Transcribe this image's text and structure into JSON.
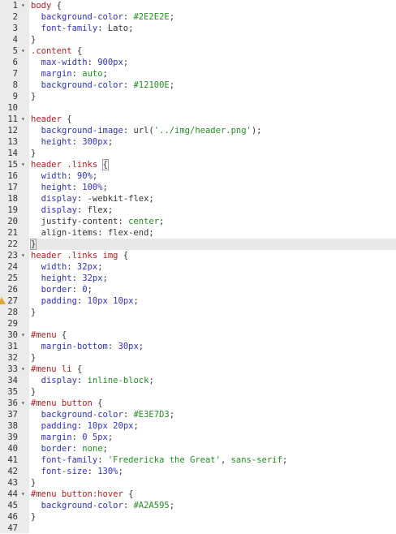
{
  "editor": {
    "lines": [
      {
        "n": "1",
        "fold": true,
        "tokens": [
          [
            "sel",
            "body"
          ],
          [
            "plain",
            " {"
          ]
        ]
      },
      {
        "n": "2",
        "tokens": [
          [
            "plain",
            "  "
          ],
          [
            "prop",
            "background-color"
          ],
          [
            "plain",
            ": "
          ],
          [
            "val",
            "#2E2E2E"
          ],
          [
            "plain",
            ";"
          ]
        ]
      },
      {
        "n": "3",
        "tokens": [
          [
            "plain",
            "  "
          ],
          [
            "prop",
            "font-family"
          ],
          [
            "plain",
            ": Lato;"
          ]
        ]
      },
      {
        "n": "4",
        "tokens": [
          [
            "plain",
            "}"
          ]
        ]
      },
      {
        "n": "5",
        "fold": true,
        "tokens": [
          [
            "sel",
            ".content"
          ],
          [
            "plain",
            " {"
          ]
        ]
      },
      {
        "n": "6",
        "tokens": [
          [
            "plain",
            "  "
          ],
          [
            "prop",
            "max-width"
          ],
          [
            "plain",
            ": "
          ],
          [
            "num-val",
            "900px"
          ],
          [
            "plain",
            ";"
          ]
        ]
      },
      {
        "n": "7",
        "tokens": [
          [
            "plain",
            "  "
          ],
          [
            "prop",
            "margin"
          ],
          [
            "plain",
            ": "
          ],
          [
            "val",
            "auto"
          ],
          [
            "plain",
            ";"
          ]
        ]
      },
      {
        "n": "8",
        "tokens": [
          [
            "plain",
            "  "
          ],
          [
            "prop",
            "background-color"
          ],
          [
            "plain",
            ": "
          ],
          [
            "val",
            "#12100E"
          ],
          [
            "plain",
            ";"
          ]
        ]
      },
      {
        "n": "9",
        "tokens": [
          [
            "plain",
            "}"
          ]
        ]
      },
      {
        "n": "10",
        "tokens": []
      },
      {
        "n": "11",
        "fold": true,
        "tokens": [
          [
            "sel",
            "header"
          ],
          [
            "plain",
            " {"
          ]
        ]
      },
      {
        "n": "12",
        "tokens": [
          [
            "plain",
            "  "
          ],
          [
            "prop",
            "background-image"
          ],
          [
            "plain",
            ": url("
          ],
          [
            "str",
            "'../img/header.png'"
          ],
          [
            "plain",
            ");"
          ]
        ]
      },
      {
        "n": "13",
        "tokens": [
          [
            "plain",
            "  "
          ],
          [
            "prop",
            "height"
          ],
          [
            "plain",
            ": "
          ],
          [
            "num-val",
            "300px"
          ],
          [
            "plain",
            ";"
          ]
        ]
      },
      {
        "n": "14",
        "tokens": [
          [
            "plain",
            "}"
          ]
        ]
      },
      {
        "n": "15",
        "fold": true,
        "tokens": [
          [
            "sel",
            "header .links"
          ],
          [
            "plain",
            " "
          ],
          [
            "bracket",
            "{"
          ]
        ]
      },
      {
        "n": "16",
        "tokens": [
          [
            "plain",
            "  "
          ],
          [
            "prop",
            "width"
          ],
          [
            "plain",
            ": "
          ],
          [
            "num-val",
            "90%"
          ],
          [
            "plain",
            ";"
          ]
        ]
      },
      {
        "n": "17",
        "tokens": [
          [
            "plain",
            "  "
          ],
          [
            "prop",
            "height"
          ],
          [
            "plain",
            ": "
          ],
          [
            "num-val",
            "100%"
          ],
          [
            "plain",
            ";"
          ]
        ]
      },
      {
        "n": "18",
        "tokens": [
          [
            "plain",
            "  "
          ],
          [
            "prop",
            "display"
          ],
          [
            "plain",
            ": -webkit-flex;"
          ]
        ]
      },
      {
        "n": "19",
        "tokens": [
          [
            "plain",
            "  "
          ],
          [
            "prop",
            "display"
          ],
          [
            "plain",
            ": flex;"
          ]
        ]
      },
      {
        "n": "20",
        "tokens": [
          [
            "plain",
            "  justify-content: "
          ],
          [
            "val",
            "center"
          ],
          [
            "plain",
            ";"
          ]
        ]
      },
      {
        "n": "21",
        "tokens": [
          [
            "plain",
            "  align-items: flex-end;"
          ]
        ]
      },
      {
        "n": "22",
        "active": true,
        "tokens": [
          [
            "bracket",
            "}"
          ]
        ]
      },
      {
        "n": "23",
        "fold": true,
        "tokens": [
          [
            "sel",
            "header .links img"
          ],
          [
            "plain",
            " {"
          ]
        ]
      },
      {
        "n": "24",
        "tokens": [
          [
            "plain",
            "  "
          ],
          [
            "prop",
            "width"
          ],
          [
            "plain",
            ": "
          ],
          [
            "num-val",
            "32px"
          ],
          [
            "plain",
            ";"
          ]
        ]
      },
      {
        "n": "25",
        "tokens": [
          [
            "plain",
            "  "
          ],
          [
            "prop",
            "height"
          ],
          [
            "plain",
            ": "
          ],
          [
            "num-val",
            "32px"
          ],
          [
            "plain",
            ";"
          ]
        ]
      },
      {
        "n": "26",
        "tokens": [
          [
            "plain",
            "  "
          ],
          [
            "prop",
            "border"
          ],
          [
            "plain",
            ": "
          ],
          [
            "num-val",
            "0"
          ],
          [
            "plain",
            ";"
          ]
        ]
      },
      {
        "n": "27",
        "warn": true,
        "tokens": [
          [
            "plain",
            "  "
          ],
          [
            "prop",
            "padding"
          ],
          [
            "plain",
            ": "
          ],
          [
            "num-val",
            "10px 10px"
          ],
          [
            "plain",
            ";"
          ]
        ]
      },
      {
        "n": "28",
        "tokens": [
          [
            "plain",
            "}"
          ]
        ]
      },
      {
        "n": "29",
        "tokens": []
      },
      {
        "n": "30",
        "fold": true,
        "tokens": [
          [
            "sel",
            "#menu"
          ],
          [
            "plain",
            " {"
          ]
        ]
      },
      {
        "n": "31",
        "tokens": [
          [
            "plain",
            "  "
          ],
          [
            "prop",
            "margin-bottom"
          ],
          [
            "plain",
            ": "
          ],
          [
            "num-val",
            "30px"
          ],
          [
            "plain",
            ";"
          ]
        ]
      },
      {
        "n": "32",
        "tokens": [
          [
            "plain",
            "}"
          ]
        ]
      },
      {
        "n": "33",
        "fold": true,
        "tokens": [
          [
            "sel",
            "#menu li"
          ],
          [
            "plain",
            " {"
          ]
        ]
      },
      {
        "n": "34",
        "tokens": [
          [
            "plain",
            "  "
          ],
          [
            "prop",
            "display"
          ],
          [
            "plain",
            ": "
          ],
          [
            "val",
            "inline-block"
          ],
          [
            "plain",
            ";"
          ]
        ]
      },
      {
        "n": "35",
        "tokens": [
          [
            "plain",
            "}"
          ]
        ]
      },
      {
        "n": "36",
        "fold": true,
        "tokens": [
          [
            "sel",
            "#menu button"
          ],
          [
            "plain",
            " {"
          ]
        ]
      },
      {
        "n": "37",
        "tokens": [
          [
            "plain",
            "  "
          ],
          [
            "prop",
            "background-color"
          ],
          [
            "plain",
            ": "
          ],
          [
            "val",
            "#E3E7D3"
          ],
          [
            "plain",
            ";"
          ]
        ]
      },
      {
        "n": "38",
        "tokens": [
          [
            "plain",
            "  "
          ],
          [
            "prop",
            "padding"
          ],
          [
            "plain",
            ": "
          ],
          [
            "num-val",
            "10px 20px"
          ],
          [
            "plain",
            ";"
          ]
        ]
      },
      {
        "n": "39",
        "tokens": [
          [
            "plain",
            "  "
          ],
          [
            "prop",
            "margin"
          ],
          [
            "plain",
            ": "
          ],
          [
            "num-val",
            "0 5px"
          ],
          [
            "plain",
            ";"
          ]
        ]
      },
      {
        "n": "40",
        "tokens": [
          [
            "plain",
            "  "
          ],
          [
            "prop",
            "border"
          ],
          [
            "plain",
            ": "
          ],
          [
            "val",
            "none"
          ],
          [
            "plain",
            ";"
          ]
        ]
      },
      {
        "n": "41",
        "tokens": [
          [
            "plain",
            "  "
          ],
          [
            "prop",
            "font-family"
          ],
          [
            "plain",
            ": "
          ],
          [
            "str",
            "'Fredericka the Great'"
          ],
          [
            "plain",
            ", "
          ],
          [
            "val",
            "sans-serif"
          ],
          [
            "plain",
            ";"
          ]
        ]
      },
      {
        "n": "42",
        "tokens": [
          [
            "plain",
            "  "
          ],
          [
            "prop",
            "font-size"
          ],
          [
            "plain",
            ": "
          ],
          [
            "num-val",
            "130%"
          ],
          [
            "plain",
            ";"
          ]
        ]
      },
      {
        "n": "43",
        "tokens": [
          [
            "plain",
            "}"
          ]
        ]
      },
      {
        "n": "44",
        "fold": true,
        "tokens": [
          [
            "sel",
            "#menu button:hover"
          ],
          [
            "plain",
            " {"
          ]
        ]
      },
      {
        "n": "45",
        "tokens": [
          [
            "plain",
            "  "
          ],
          [
            "prop",
            "background-color"
          ],
          [
            "plain",
            ": "
          ],
          [
            "val",
            "#A2A595"
          ],
          [
            "plain",
            ";"
          ]
        ]
      },
      {
        "n": "46",
        "tokens": [
          [
            "plain",
            "}"
          ]
        ]
      },
      {
        "n": "47",
        "tokens": []
      }
    ]
  }
}
